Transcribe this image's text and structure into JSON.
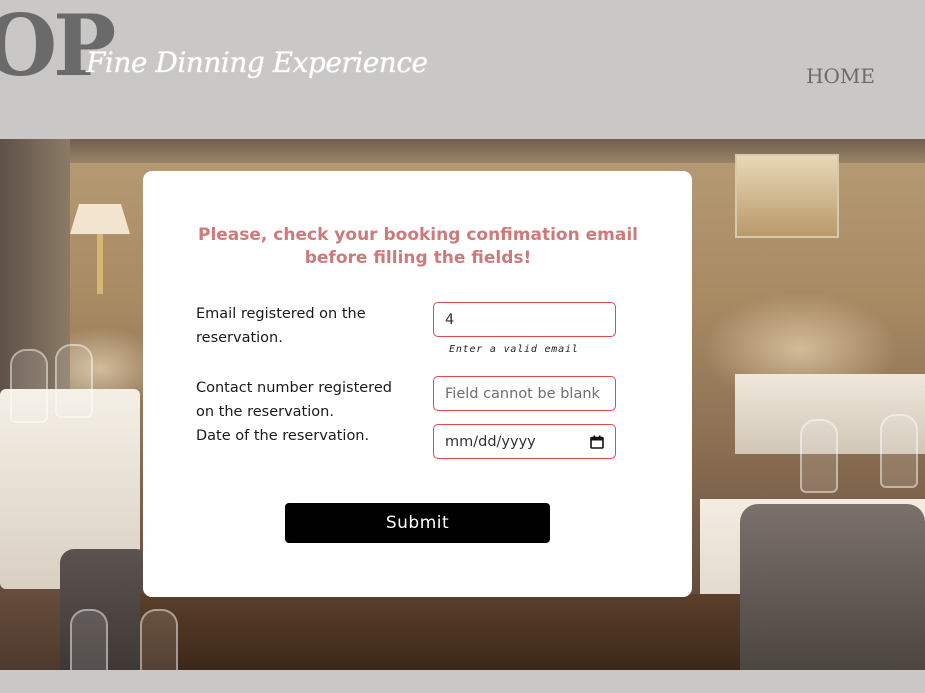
{
  "header": {
    "logo_text": "OP",
    "tagline": "Fine Dinning Experience",
    "nav": {
      "home_label": "HOME"
    }
  },
  "form": {
    "title": "Please, check your booking confimation email before filling the fields!",
    "email": {
      "label": "Email registered on the reservation.",
      "value": "4",
      "hint": "Enter a valid email"
    },
    "contact": {
      "label": "Contact number registered on the reservation.",
      "placeholder": "Field cannot be blank"
    },
    "date": {
      "label": "Date of the reservation.",
      "display": "mm/dd/yyyy",
      "icon": "calendar-icon"
    },
    "submit_label": "Submit"
  },
  "colors": {
    "page_bg": "#c9c8c7",
    "title": "#cf7a7a",
    "error_border": "#e04a4a",
    "button_bg": "#000000"
  }
}
